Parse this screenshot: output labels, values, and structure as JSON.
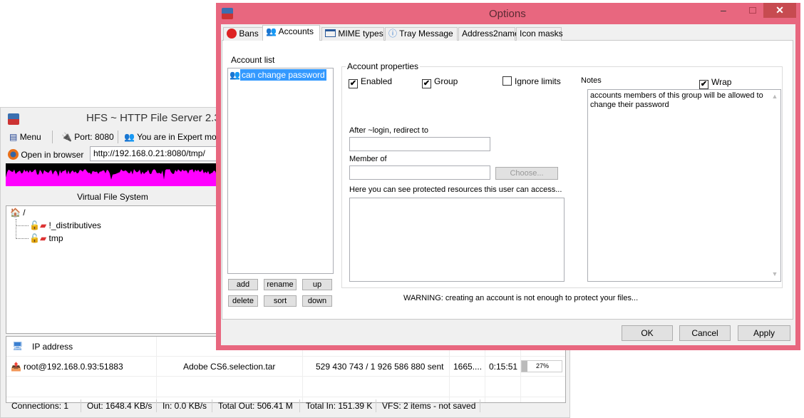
{
  "main": {
    "title": "HFS ~ HTTP File Server 2.3",
    "toolbar": {
      "menu": "Menu",
      "port": "Port: 8080",
      "mode": "You are in Expert mo"
    },
    "open_browser": "Open in browser",
    "url": "http://192.168.0.21:8080/tmp/",
    "graph_color": "#ff00ff",
    "vfs_header": "Virtual File System",
    "tree": [
      {
        "label": "/"
      },
      {
        "label": "!_distributives"
      },
      {
        "label": "tmp"
      }
    ],
    "connections": {
      "columns": [
        "IP address"
      ],
      "rows": [
        {
          "ip": "root@192.168.0.93:51883",
          "file": "Adobe CS6.selection.tar",
          "status": "529 430 743 / 1 926 586 880 sent",
          "speed": "1665....",
          "time": "0:15:51",
          "progress": "27%",
          "progress_value": 27
        }
      ]
    },
    "status": [
      "Connections: 1",
      "Out: 1648.4 KB/s",
      "In: 0.0 KB/s",
      "Total Out: 506.41 M",
      "Total In: 151.39 K",
      "VFS: 2 items - not saved"
    ]
  },
  "options": {
    "title": "Options",
    "accent": "#e8677f",
    "tabs": [
      "Bans",
      "Accounts",
      "MIME types",
      "Tray Message",
      "Address2name",
      "Icon masks"
    ],
    "active_tab": "Accounts",
    "account_list_label": "Account list",
    "accounts": [
      "can change password"
    ],
    "list_buttons": [
      "add",
      "rename",
      "up",
      "delete",
      "sort",
      "down"
    ],
    "props_label": "Account properties",
    "enabled": {
      "label": "Enabled",
      "checked": true
    },
    "group": {
      "label": "Group",
      "checked": true
    },
    "ignore_limits": {
      "label": "Ignore limits",
      "checked": false
    },
    "redirect_label": "After ~login, redirect to",
    "redirect_value": "",
    "member_of_label": "Member of",
    "member_of_value": "",
    "choose": "Choose...",
    "resources_label": "Here you can see protected resources this user can access...",
    "notes_label": "Notes",
    "wrap": {
      "label": "Wrap",
      "checked": true
    },
    "notes": "accounts members of this group will be allowed to change their password",
    "warning": "WARNING: creating an account is not enough to protect  your files...",
    "ok": "OK",
    "cancel": "Cancel",
    "apply": "Apply"
  }
}
